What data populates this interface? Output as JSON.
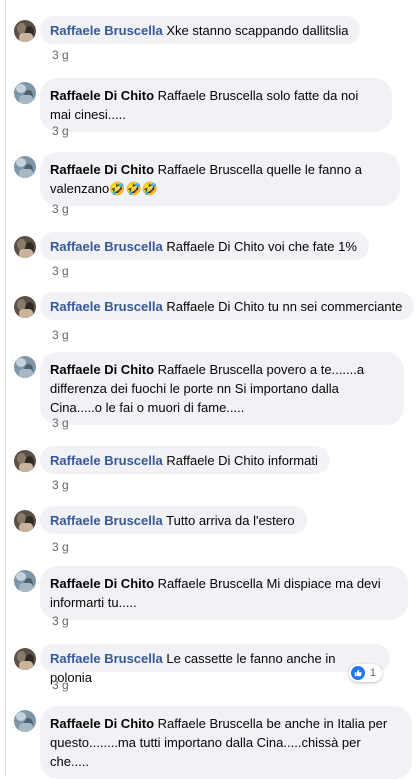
{
  "comments": [
    {
      "author": "Raffaele Bruscella",
      "text": "Xke stanno scappando dallitslia",
      "time": "3 g"
    },
    {
      "author": "Raffaele Di Chito",
      "text": "Raffaele Bruscella solo fatte da noi mai cinesi.....",
      "time": "3 g"
    },
    {
      "author": "Raffaele Di Chito",
      "text": "Raffaele Bruscella quelle le fanno a valenzano",
      "emoji": "🤣🤣🤣",
      "time": "3 g"
    },
    {
      "author": "Raffaele Bruscella",
      "text": "Raffaele Di Chito voi che fate 1%",
      "time": "3 g"
    },
    {
      "author": "Raffaele Bruscella",
      "text": "Raffaele Di Chito tu nn sei commerciante",
      "time": "3 g"
    },
    {
      "author": "Raffaele Di Chito",
      "text": "Raffaele Bruscella povero a te.......a differenza dei fuochi le porte nn Si importano dalla Cina.....o le fai o muori di fame.....",
      "time": "3 g"
    },
    {
      "author": "Raffaele Bruscella",
      "text": "Raffaele Di Chito informati",
      "time": "3 g"
    },
    {
      "author": "Raffaele Bruscella",
      "text": "Tutto arriva da l'estero",
      "time": "3 g"
    },
    {
      "author": "Raffaele Di Chito",
      "text": "Raffaele Bruscella Mi dispiace ma devi informarti tu.....",
      "time": "3 g"
    },
    {
      "author": "Raffaele Bruscella",
      "text": "Le cassette le fanno anche in polonia",
      "time": "3 g",
      "reaction": {
        "icon": "like-icon",
        "count": "1",
        "color": "#2078f4"
      }
    },
    {
      "author": "Raffaele Di Chito",
      "text": "Raffaele Bruscella be anche in Italia per questo........ma tutti importano dalla Cina.....chissà per che.....",
      "time": ""
    }
  ]
}
